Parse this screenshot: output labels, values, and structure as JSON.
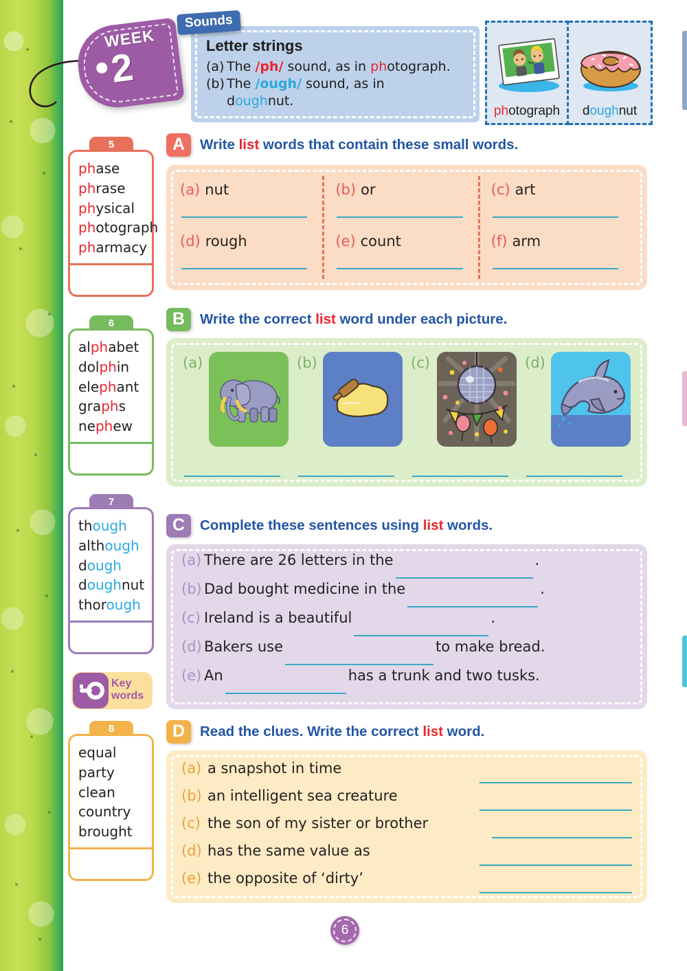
{
  "week": {
    "label": "WEEK",
    "number": "2"
  },
  "sounds_tab": "Sounds",
  "header": {
    "title": "Letter strings",
    "a_key": "(a)",
    "a_pre": "The ",
    "a_sound": "/ph/",
    "a_mid": " sound, as in ",
    "a_word_hl": "ph",
    "a_word_rest": "otograph.",
    "b_key": "(b)",
    "b_pre": "The ",
    "b_sound": "/ough/",
    "b_mid": " sound, as in",
    "b_word_pre": "d",
    "b_word_hl": "ough",
    "b_word_rest": "nut."
  },
  "examples": [
    {
      "caption_pre": "ph",
      "caption_hl_color": "#e8262f",
      "caption_rest": "otograph",
      "art": "photograph-art"
    },
    {
      "caption_pre": "d",
      "caption_mid": "ough",
      "caption_rest": "nut",
      "art": "doughnut-art"
    }
  ],
  "wordlists": [
    {
      "number": "5",
      "color": "#e8705a",
      "highlight": "#e8262f",
      "words": [
        {
          "pre": "",
          "hl": "ph",
          "post": "ase"
        },
        {
          "pre": "",
          "hl": "ph",
          "post": "rase"
        },
        {
          "pre": "",
          "hl": "ph",
          "post": "ysical"
        },
        {
          "pre": "",
          "hl": "ph",
          "post": "otograph"
        },
        {
          "pre": "",
          "hl": "ph",
          "post": "armacy"
        }
      ]
    },
    {
      "number": "6",
      "color": "#76bb5e",
      "highlight": "#e8262f",
      "words": [
        {
          "pre": "al",
          "hl": "ph",
          "post": "abet"
        },
        {
          "pre": "dol",
          "hl": "ph",
          "post": "in"
        },
        {
          "pre": "ele",
          "hl": "ph",
          "post": "ant"
        },
        {
          "pre": "gra",
          "hl": "ph",
          "post": "s"
        },
        {
          "pre": "ne",
          "hl": "ph",
          "post": "ew"
        }
      ]
    },
    {
      "number": "7",
      "color": "#9d7bb5",
      "highlight": "#2aa9e0",
      "words": [
        {
          "pre": "th",
          "hl": "ough",
          "post": ""
        },
        {
          "pre": "alth",
          "hl": "ough",
          "post": ""
        },
        {
          "pre": "d",
          "hl": "ough",
          "post": ""
        },
        {
          "pre": "d",
          "hl": "ough",
          "post": "nut"
        },
        {
          "pre": "thor",
          "hl": "ough",
          "post": ""
        }
      ]
    },
    {
      "number": "8",
      "color": "#f1b34a",
      "highlight": "#231f20",
      "words": [
        {
          "pre": "equal",
          "hl": "",
          "post": ""
        },
        {
          "pre": "party",
          "hl": "",
          "post": ""
        },
        {
          "pre": "clean",
          "hl": "",
          "post": ""
        },
        {
          "pre": "country",
          "hl": "",
          "post": ""
        },
        {
          "pre": "brought",
          "hl": "",
          "post": ""
        }
      ]
    }
  ],
  "keywords_badge": {
    "line1": "Key",
    "line2": "words",
    "icon": "key-icon"
  },
  "exercises": {
    "a": {
      "letter": "A",
      "badge_color": "#ef6f61",
      "title_pre": "Write ",
      "title_red": "list",
      "title_post": " words that contain these small words.",
      "items": [
        {
          "key": "(a)",
          "text": "nut"
        },
        {
          "key": "(b)",
          "text": "or"
        },
        {
          "key": "(c)",
          "text": "art"
        },
        {
          "key": "(d)",
          "text": "rough"
        },
        {
          "key": "(e)",
          "text": "count"
        },
        {
          "key": "(f)",
          "text": "arm"
        }
      ]
    },
    "b": {
      "letter": "B",
      "badge_color": "#76bb5e",
      "title_pre": "Write the correct ",
      "title_red": "list",
      "title_post": " word under each picture.",
      "items": [
        {
          "key": "(a)",
          "picture": "elephant-picture",
          "bg": "#7cc05a"
        },
        {
          "key": "(b)",
          "picture": "dough-picture",
          "bg": "#5c7fc6"
        },
        {
          "key": "(c)",
          "picture": "disco-ball-party-picture",
          "bg": "#6b6258"
        },
        {
          "key": "(d)",
          "picture": "dolphin-picture",
          "bg": "#4ec3ec"
        }
      ]
    },
    "c": {
      "letter": "C",
      "badge_color": "#9d7bb5",
      "title_pre": "Complete these sentences using ",
      "title_red": "list",
      "title_post": " words.",
      "items": [
        {
          "key": "(a)",
          "before": "There are 26 letters in the",
          "after": ".",
          "blank_width": 200
        },
        {
          "key": "(b)",
          "before": "Dad bought medicine in the",
          "after": ".",
          "blank_width": 190
        },
        {
          "key": "(c)",
          "before": "Ireland is a beautiful",
          "after": ".",
          "blank_width": 196
        },
        {
          "key": "(d)",
          "before": "Bakers use",
          "after": "to make bread.",
          "blank_width": 216
        },
        {
          "key": "(e)",
          "before": "An",
          "after": "has a trunk and two tusks.",
          "blank_width": 176
        }
      ]
    },
    "d": {
      "letter": "D",
      "badge_color": "#f1b34a",
      "title_pre": "Read the clues. Write the correct ",
      "title_red": "list",
      "title_post": " word.",
      "items": [
        {
          "key": "(a)",
          "clue": "a snapshot in time"
        },
        {
          "key": "(b)",
          "clue": "an intelligent sea creature"
        },
        {
          "key": "(c)",
          "clue": "the son of my sister or brother"
        },
        {
          "key": "(d)",
          "clue": "has the same value as"
        },
        {
          "key": "(e)",
          "clue": "the opposite of ‘dirty’"
        }
      ]
    }
  },
  "page_number": "6",
  "colors": {
    "header_bg": "#bdd1ea",
    "panel_a": "#fbdcc4",
    "panel_b": "#dcedca",
    "panel_c": "#e3d7ea",
    "panel_d": "#fcebc5",
    "blue_heading": "#2255a4",
    "red": "#e8262f",
    "answer_line": "#3aa9c4"
  }
}
